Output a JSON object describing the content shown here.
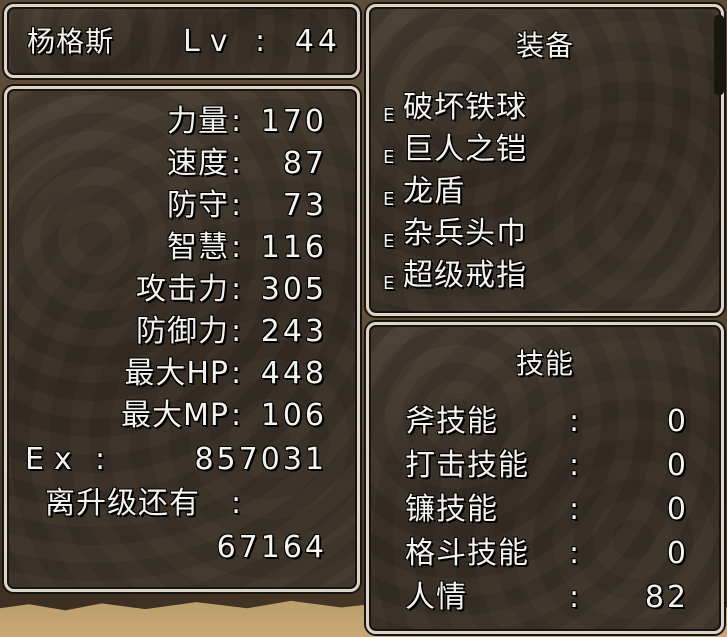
{
  "header": {
    "name": "杨格斯",
    "level_label": "Lv",
    "level_sep": ":",
    "level_value": "44"
  },
  "stats": [
    {
      "label": "力量",
      "sep": ":",
      "value": "170"
    },
    {
      "label": "速度",
      "sep": ":",
      "value": "87"
    },
    {
      "label": "防守",
      "sep": ":",
      "value": "73"
    },
    {
      "label": "智慧",
      "sep": ":",
      "value": "116"
    },
    {
      "label": "攻击力",
      "sep": ":",
      "value": "305"
    },
    {
      "label": "防御力",
      "sep": ":",
      "value": "243"
    },
    {
      "label": "最大HP",
      "sep": ":",
      "value": "448"
    },
    {
      "label": "最大MP",
      "sep": ":",
      "value": "106"
    }
  ],
  "experience": {
    "label": "Ex",
    "sep": ":",
    "value": "857031"
  },
  "next_level": {
    "label": "离升级还有",
    "sep": ":",
    "value": "67164"
  },
  "equipment": {
    "title": "装备",
    "items": [
      {
        "mark": "E",
        "name": "破坏铁球"
      },
      {
        "mark": "E",
        "name": "巨人之铠"
      },
      {
        "mark": "E",
        "name": "龙盾"
      },
      {
        "mark": "E",
        "name": "杂兵头巾"
      },
      {
        "mark": "E",
        "name": "超级戒指"
      }
    ]
  },
  "skills": {
    "title": "技能",
    "items": [
      {
        "name": "斧技能",
        "sep": ":",
        "value": "0"
      },
      {
        "name": "打击技能",
        "sep": ":",
        "value": "0"
      },
      {
        "name": "镰技能",
        "sep": ":",
        "value": "0"
      },
      {
        "name": "格斗技能",
        "sep": ":",
        "value": "0"
      },
      {
        "name": "人情",
        "sep": ":",
        "value": "82"
      }
    ]
  }
}
